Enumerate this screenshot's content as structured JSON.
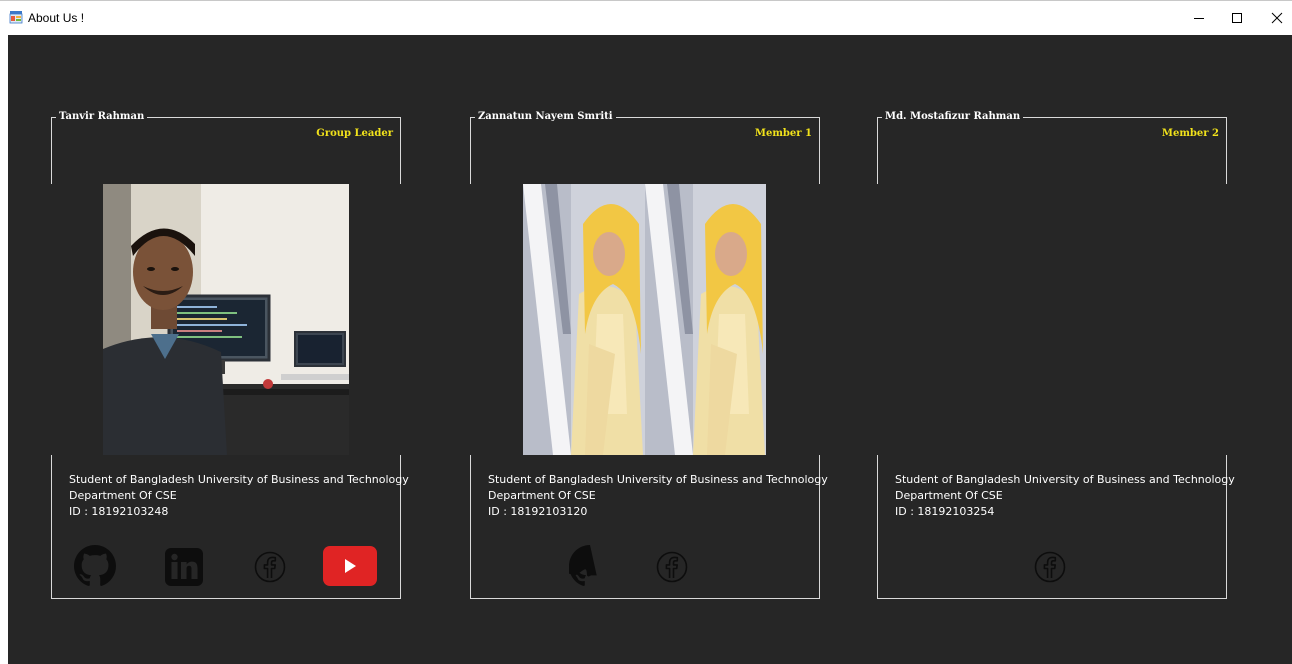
{
  "window": {
    "title": "About Us !",
    "icons": {
      "app": "app-icon",
      "minimize": "minimize-icon",
      "maximize": "maximize-icon",
      "close": "close-icon"
    }
  },
  "colors": {
    "background": "#262626",
    "role_text": "#f1e21b",
    "youtube": "#e02424",
    "social_icon": "#0d0d0d"
  },
  "members": [
    {
      "name": "Tanvir Rahman",
      "role": "Group Leader",
      "info": {
        "line1": "Student of Bangladesh University of Business and Technology",
        "line2": "Department Of CSE",
        "line3": "ID : 18192103248"
      },
      "social": [
        "github-icon",
        "linkedin-icon",
        "facebook-icon",
        "youtube-icon"
      ]
    },
    {
      "name": "Zannatun Nayem Smriti",
      "role": "Member 1",
      "info": {
        "line1": "Student of Bangladesh University of Business and Technology",
        "line2": "Department Of CSE",
        "line3": "ID : 18192103120"
      },
      "social": [
        "github-icon",
        "facebook-icon"
      ]
    },
    {
      "name": "Md. Mostafizur Rahman",
      "role": "Member 2",
      "info": {
        "line1": "Student of Bangladesh University of Business and Technology",
        "line2": "Department Of CSE",
        "line3": "ID : 18192103254"
      },
      "social": [
        "facebook-icon"
      ]
    }
  ]
}
